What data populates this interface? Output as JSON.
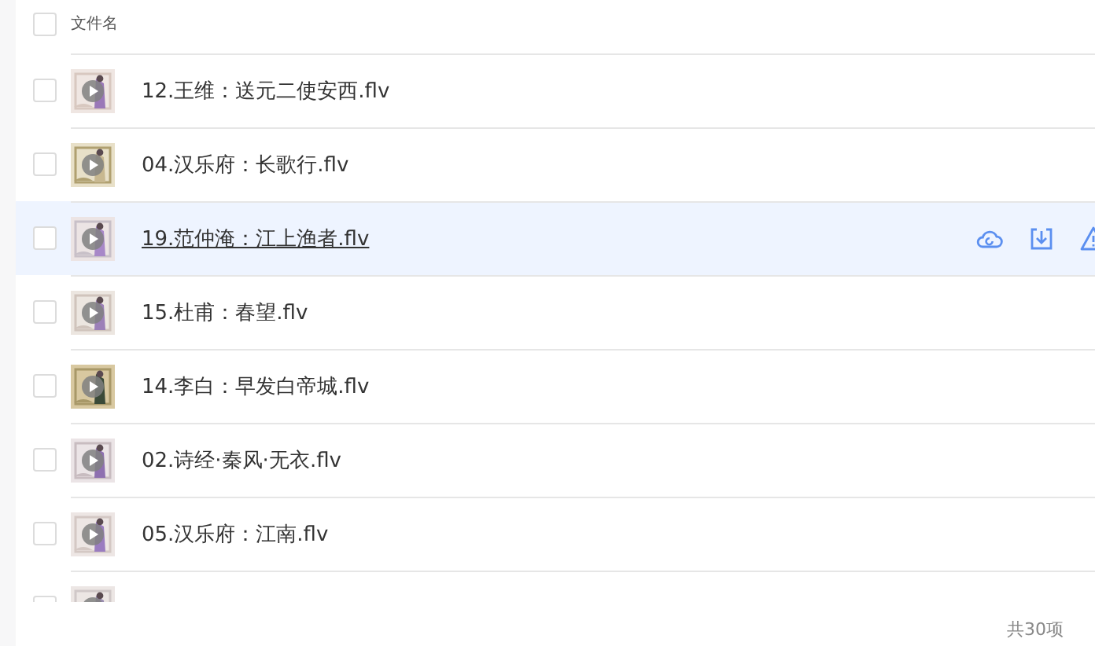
{
  "header": {
    "checked": false,
    "label": "文件名"
  },
  "files": [
    {
      "name": "12.王维：送元二使安西.flv",
      "checked": false,
      "hovered": false
    },
    {
      "name": "04.汉乐府：长歌行.flv",
      "checked": false,
      "hovered": false
    },
    {
      "name": "19.范仲淹：江上渔者.flv",
      "checked": false,
      "hovered": true
    },
    {
      "name": "15.杜甫：春望.flv",
      "checked": false,
      "hovered": false
    },
    {
      "name": "14.李白：早发白帝城.flv",
      "checked": false,
      "hovered": false
    },
    {
      "name": "02.诗经·秦风·无衣.flv",
      "checked": false,
      "hovered": false
    },
    {
      "name": "05.汉乐府：江南.flv",
      "checked": false,
      "hovered": false
    },
    {
      "checked": false,
      "hovered": false
    }
  ],
  "footer": {
    "count": "共30项"
  }
}
